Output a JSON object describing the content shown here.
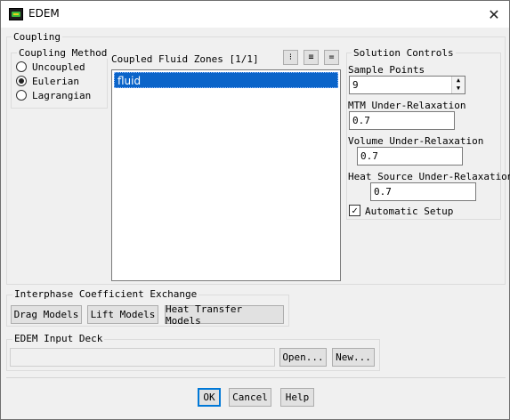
{
  "window": {
    "title": "EDEM"
  },
  "coupling": {
    "group_title": "Coupling",
    "method": {
      "group_title": "Coupling Method",
      "options": [
        {
          "label": "Uncoupled",
          "checked": false
        },
        {
          "label": "Eulerian",
          "checked": true
        },
        {
          "label": "Lagrangian",
          "checked": false
        }
      ]
    },
    "zones": {
      "title": "Coupled Fluid Zones [1/1]",
      "items": [
        "fluid"
      ],
      "toolbar_icons": [
        "select-all-icon",
        "list-icon",
        "deselect-icon"
      ]
    },
    "solution_controls": {
      "group_title": "Solution Controls",
      "sample_points_label": "Sample Points",
      "sample_points_value": "9",
      "mtm_label": "MTM Under-Relaxation",
      "mtm_value": "0.7",
      "volume_label": "Volume Under-Relaxation",
      "volume_value": "0.7",
      "heat_label": "Heat Source Under-Relaxation",
      "heat_value": "0.7",
      "auto_setup_label": "Automatic Setup",
      "auto_setup_checked": true
    }
  },
  "interphase": {
    "group_title": "Interphase Coefficient Exchange",
    "buttons": [
      "Drag Models",
      "Lift Models",
      "Heat Transfer Models"
    ]
  },
  "input_deck": {
    "group_title": "EDEM Input Deck",
    "path_value": "",
    "open_label": "Open...",
    "new_label": "New..."
  },
  "footer": {
    "ok_label": "OK",
    "cancel_label": "Cancel",
    "help_label": "Help"
  }
}
